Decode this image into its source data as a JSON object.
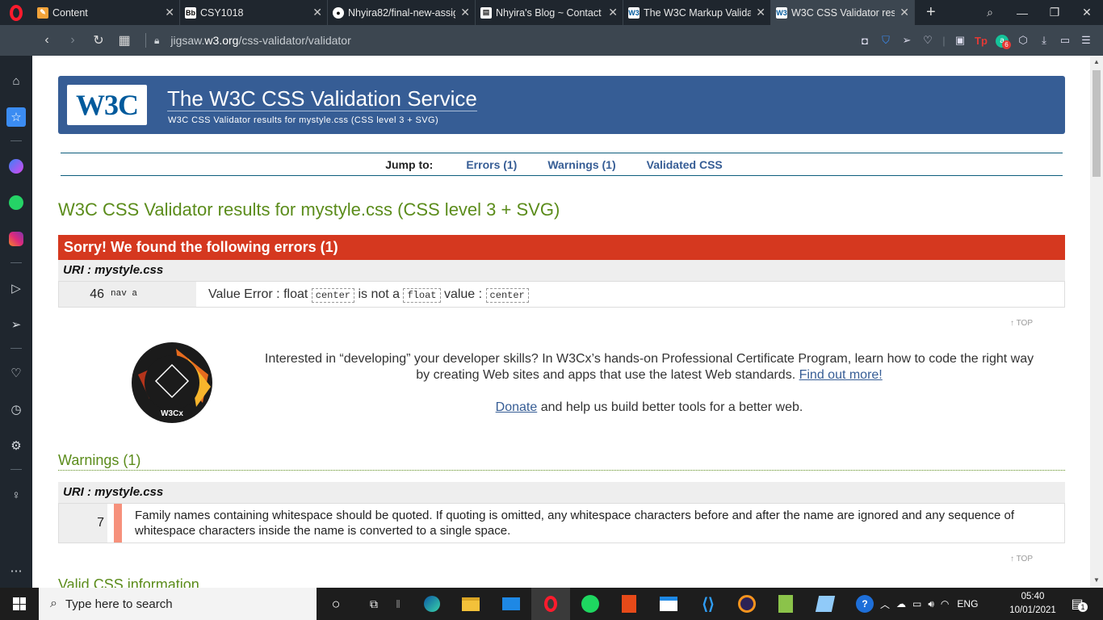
{
  "browser": {
    "tabs": [
      {
        "title": "Content",
        "fav": "pencil",
        "favcolor": "#f2a33a",
        "active": false
      },
      {
        "title": "CSY1018",
        "fav": "Bb",
        "favcolor": "#222222",
        "active": false
      },
      {
        "title": "Nhyira82/final-new-assig",
        "fav": "github",
        "favcolor": "#ffffff",
        "active": false
      },
      {
        "title": "Nhyira's Blog ~ Contact",
        "fav": "page",
        "favcolor": "#ffffff",
        "active": false
      },
      {
        "title": "The W3C Markup Validat",
        "fav": "W3",
        "favcolor": "#ffffff",
        "active": false
      },
      {
        "title": "W3C CSS Validator resul",
        "fav": "W3",
        "favcolor": "#ffffff",
        "active": true
      }
    ],
    "url_prefix": "jigsaw.",
    "url_domain": "w3.org",
    "url_path": "/css-validator/validator",
    "badge_count": "6"
  },
  "page": {
    "banner": {
      "logo": "W3C",
      "title": "The W3C CSS Validation Service",
      "subtitle": "W3C CSS Validator results for mystyle.css (CSS level 3 + SVG)"
    },
    "jump": {
      "label": "Jump to:",
      "errors": "Errors (1)",
      "warnings": "Warnings (1)",
      "validated": "Validated CSS"
    },
    "results_heading": "W3C CSS Validator results for mystyle.css (CSS level 3 + SVG)",
    "errors": {
      "heading": "Sorry! We found the following errors (1)",
      "uri": "URI : mystyle.css",
      "items": [
        {
          "line": "46",
          "context": "nav a",
          "msg_prefix": "Value Error : float",
          "code1": "center",
          "msg_mid": "is not a",
          "code2": "float",
          "msg_after": "value :",
          "code3": "center"
        }
      ]
    },
    "top_label": "↑ TOP",
    "promo": {
      "text": "Interested in “developing” your developer skills? In W3Cx’s hands-on Professional Certificate Program, learn how to code the right way by creating Web sites and apps that use the latest Web standards.",
      "link": "Find out more!",
      "donate_link": "Donate",
      "donate_text": "and help us build better tools for a better web.",
      "badge_text": "W3Cx"
    },
    "warnings": {
      "heading": "Warnings (1)",
      "uri": "URI : mystyle.css",
      "items": [
        {
          "line": "7",
          "msg": "Family names containing whitespace should be quoted. If quoting is omitted, any whitespace characters before and after the name are ignored and any sequence of whitespace characters inside the name is converted to a single space."
        }
      ]
    },
    "valid_heading": "Valid CSS information"
  },
  "taskbar": {
    "search_placeholder": "Type here to search",
    "lang": "ENG",
    "time": "05:40",
    "date": "10/01/2021",
    "notif_count": "1"
  },
  "colors": {
    "banner": "#365d95",
    "error": "#d5381f",
    "heading_green": "#5b8c1b"
  }
}
